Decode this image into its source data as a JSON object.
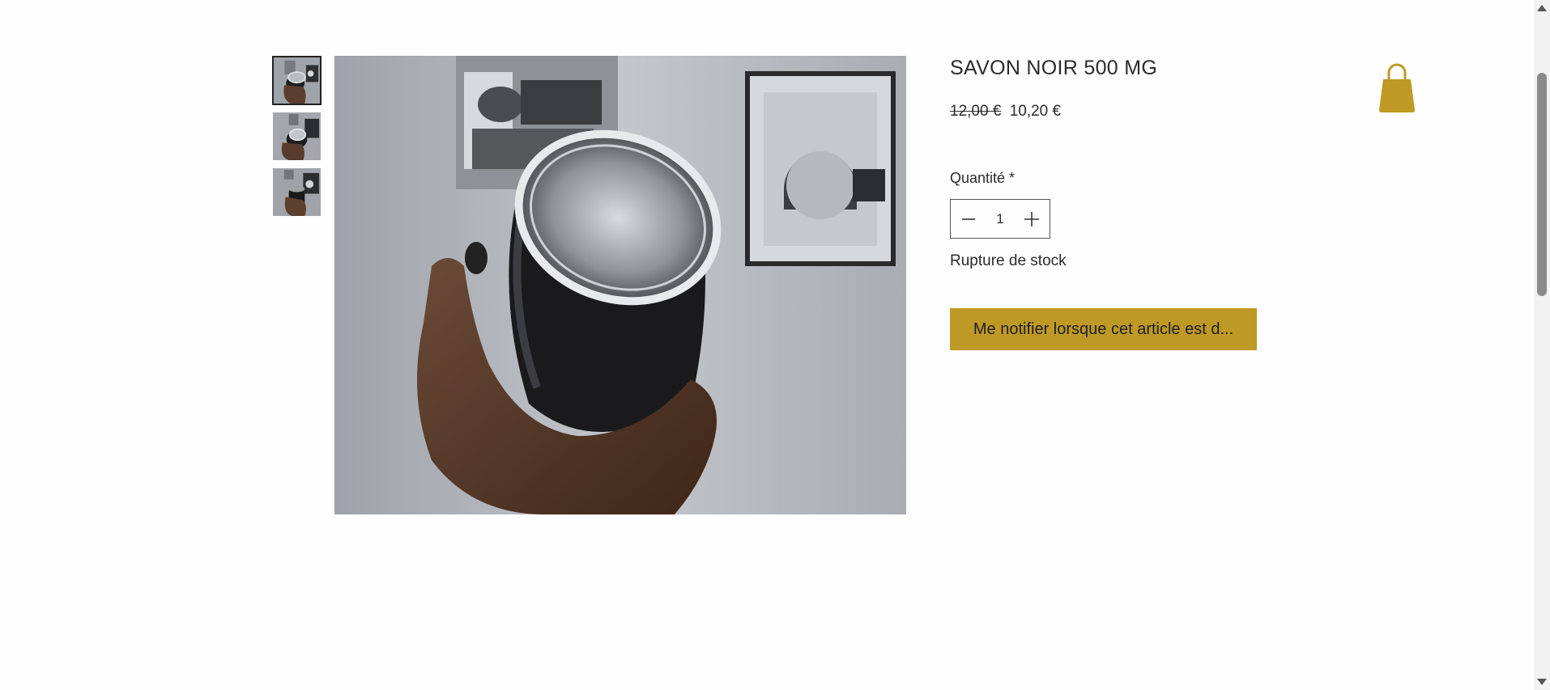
{
  "product": {
    "title": "SAVON NOIR 500 MG",
    "price_original": "12,00 €",
    "price_sale": "10,20 €",
    "quantity_label": "Quantité *",
    "quantity_value": "1",
    "stock_status": "Rupture de stock",
    "notify_button_label": "Me notifier lorsque cet article est d..."
  },
  "gallery": {
    "selected_index": 0,
    "thumbnail_count": 3
  },
  "icons": {
    "cart": "shopping-bag-icon",
    "minus": "minus-icon",
    "plus": "plus-icon",
    "scroll_up": "triangle-up-icon",
    "scroll_down": "triangle-down-icon"
  },
  "colors": {
    "accent": "#bf9926",
    "text": "#2b2b2b",
    "background": "#fefefe"
  }
}
